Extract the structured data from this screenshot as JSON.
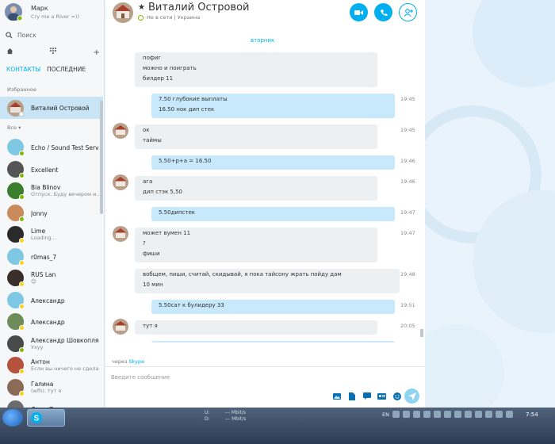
{
  "me": {
    "name": "Марк",
    "mood": "Cry me a River =))"
  },
  "search": {
    "label": "Поиск"
  },
  "tabs": [
    "КОНТАКТЫ",
    "ПОСЛЕДНИЕ"
  ],
  "sections": {
    "favorites": "Избранное",
    "all": "Все ▾"
  },
  "favorite": {
    "name": "Виталий Островой"
  },
  "contacts": [
    {
      "name": "Echo / Sound Test Serv...",
      "status": "",
      "badge": "green"
    },
    {
      "name": "Excellent",
      "status": "",
      "badge": "green"
    },
    {
      "name": "Bia Blinov",
      "status": "Отпуск. Буду вечером и...",
      "badge": "green"
    },
    {
      "name": "Jonny",
      "status": "",
      "badge": "green"
    },
    {
      "name": "Lime",
      "status": "Loading...",
      "badge": "yellow"
    },
    {
      "name": "r0mas_7",
      "status": "",
      "badge": "yellow"
    },
    {
      "name": "RUS Lan",
      "status": "😊",
      "badge": "yellow"
    },
    {
      "name": "Александр",
      "status": "",
      "badge": "yellow"
    },
    {
      "name": "Александр",
      "status": "",
      "badge": "yellow"
    },
    {
      "name": "Александр Шовкопляс",
      "status": "Ухуу",
      "badge": "green"
    },
    {
      "name": "Антон",
      "status": "Если вы ничего не сдела...",
      "badge": "yellow"
    },
    {
      "name": "Галина",
      "status": "(wfh). тут я",
      "badge": "yellow"
    },
    {
      "name": "Дима Тарасюк",
      "status": "",
      "badge": "yellow"
    }
  ],
  "header": {
    "name": "Виталий Островой",
    "status": "Не в сети | Украина"
  },
  "day": "вторник",
  "messages": [
    {
      "dir": "in",
      "lines": [
        "пофиг",
        "можно и поиграть",
        "билдер 11"
      ],
      "time": ""
    },
    {
      "dir": "out",
      "lines": [
        "7.50 глубокие выплаты",
        "16.50 нок дип стек"
      ],
      "time": "19:45"
    },
    {
      "dir": "in",
      "lines": [
        "ок",
        "таймы"
      ],
      "time": "19:45"
    },
    {
      "dir": "out",
      "lines": [
        "5.50+р+а = 16.50"
      ],
      "time": "19:46"
    },
    {
      "dir": "in",
      "lines": [
        "ага",
        "дип стэк 5,50"
      ],
      "time": "19:46"
    },
    {
      "dir": "out",
      "lines": [
        "5.50дипстек"
      ],
      "time": "19:47"
    },
    {
      "dir": "in",
      "lines": [
        "может вумен 11",
        "?",
        "фиши"
      ],
      "time": "19:47"
    },
    {
      "dir": "in",
      "lines": [
        "вобщем, пиши, считай, скидывай, я пока тайсону жрать пойду дам",
        "10 мин"
      ],
      "time": "19:48"
    },
    {
      "dir": "out",
      "lines": [
        "5.50сат к булидеру 33"
      ],
      "time": "19:51"
    },
    {
      "dir": "in",
      "lines": [
        "тут я"
      ],
      "time": "20:05"
    }
  ],
  "via": {
    "prefix": "через",
    "link": "Skype"
  },
  "compose": {
    "placeholder": "Введите сообщение"
  },
  "taskbar": {
    "net": "U:          --- Mbit/s\nD:          --- Mbit/s",
    "lang": "EN",
    "time": "7:54"
  },
  "colors": {
    "accent": "#00aff0",
    "bubble_out": "#c7e9fb",
    "bubble_in": "#edf0f2",
    "selected": "#c8e4f5"
  }
}
